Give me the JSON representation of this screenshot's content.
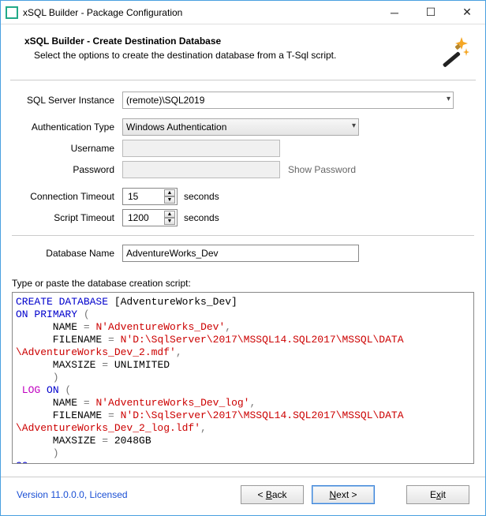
{
  "window": {
    "title": "xSQL Builder - Package Configuration"
  },
  "header": {
    "title": "xSQL Builder - Create Destination Database",
    "subtitle": "Select the options to create the destination database from a T-Sql script."
  },
  "form": {
    "sql_server_label": "SQL Server Instance",
    "sql_server_value": "(remote)\\SQL2019",
    "auth_type_label": "Authentication Type",
    "auth_type_value": "Windows Authentication",
    "username_label": "Username",
    "username_value": "",
    "password_label": "Password",
    "password_value": "",
    "show_password_label": "Show Password",
    "conn_timeout_label": "Connection Timeout",
    "conn_timeout_value": "15",
    "script_timeout_label": "Script Timeout",
    "script_timeout_value": "1200",
    "seconds_label": "seconds",
    "database_name_label": "Database Name",
    "database_name_value": "AdventureWorks_Dev",
    "script_prompt": "Type or paste the database creation script:"
  },
  "script": {
    "l1a": "CREATE",
    "l1b": " DATABASE",
    "l1c": " [AdventureWorks_Dev]",
    "l2a": "ON",
    "l2b": " PRIMARY",
    "l2c": " (",
    "l3a": "      NAME ",
    "l3b": "=",
    "l3c": " N'AdventureWorks_Dev'",
    "l3d": ",",
    "l4a": "      FILENAME ",
    "l4b": "=",
    "l4c": " N'D:\\SqlServer\\2017\\MSSQL14.SQL2017\\MSSQL\\DATA",
    "l5a": "\\AdventureWorks_Dev_2.mdf'",
    "l5b": ",",
    "l6a": "      MAXSIZE ",
    "l6b": "=",
    "l6c": " UNLIMITED",
    "l7": "      )",
    "l8a": " LOG ",
    "l8b": "ON",
    "l8c": " (",
    "l9a": "      NAME ",
    "l9b": "=",
    "l9c": " N'AdventureWorks_Dev_log'",
    "l9d": ",",
    "l10a": "      FILENAME ",
    "l10b": "=",
    "l10c": " N'D:\\SqlServer\\2017\\MSSQL14.SQL2017\\MSSQL\\DATA",
    "l11a": "\\AdventureWorks_Dev_2_log.ldf'",
    "l11b": ",",
    "l12a": "      MAXSIZE ",
    "l12b": "=",
    "l12c": " 2048GB",
    "l13": "      )",
    "l14": "GO"
  },
  "footer": {
    "version": "Version 11.0.0.0, Licensed",
    "back": "< Back",
    "next": "Next >",
    "exit": "Exit"
  }
}
